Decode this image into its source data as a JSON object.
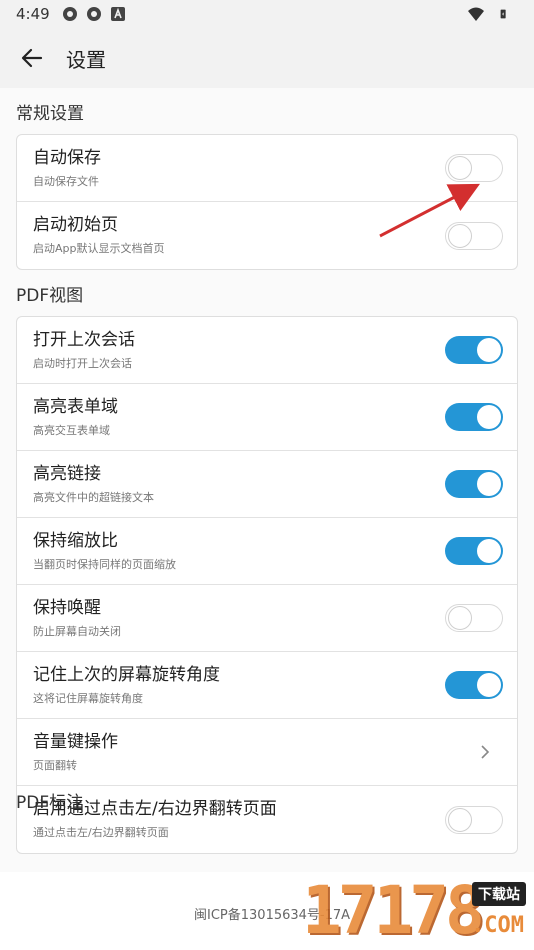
{
  "status_bar": {
    "time": "4:49"
  },
  "app_bar": {
    "title": "设置"
  },
  "sections": {
    "general": {
      "title": "常规设置",
      "items": [
        {
          "label": "自动保存",
          "sub": "自动保存文件",
          "state": "off"
        },
        {
          "label": "启动初始页",
          "sub": "启动App默认显示文档首页",
          "state": "off"
        }
      ]
    },
    "pdf_view": {
      "title": "PDF视图",
      "items": [
        {
          "label": "打开上次会话",
          "sub": "启动时打开上次会话",
          "state": "on"
        },
        {
          "label": "高亮表单域",
          "sub": "高亮交互表单域",
          "state": "on"
        },
        {
          "label": "高亮链接",
          "sub": "高亮文件中的超链接文本",
          "state": "on"
        },
        {
          "label": "保持缩放比",
          "sub": "当翻页时保持同样的页面缩放",
          "state": "on"
        },
        {
          "label": "保持唤醒",
          "sub": "防止屏幕自动关闭",
          "state": "off"
        },
        {
          "label": "记住上次的屏幕旋转角度",
          "sub": "这将记住屏幕旋转角度",
          "state": "on"
        },
        {
          "label": "音量键操作",
          "sub": "页面翻转",
          "state": "chevron"
        },
        {
          "label": "启用通过点击左/右边界翻转页面",
          "sub": "通过点击左/右边界翻转页面",
          "state": "off"
        }
      ]
    },
    "next_peek": {
      "title": "PDF标注"
    }
  },
  "footer": {
    "icp": "闽ICP备13015634号-17A",
    "watermark_digits": "17178",
    "watermark_tag": "下载站",
    "watermark_suffix": ".COM"
  },
  "colors": {
    "toggle_on": "#2496d6",
    "annotation_arrow": "#d32f2f"
  }
}
